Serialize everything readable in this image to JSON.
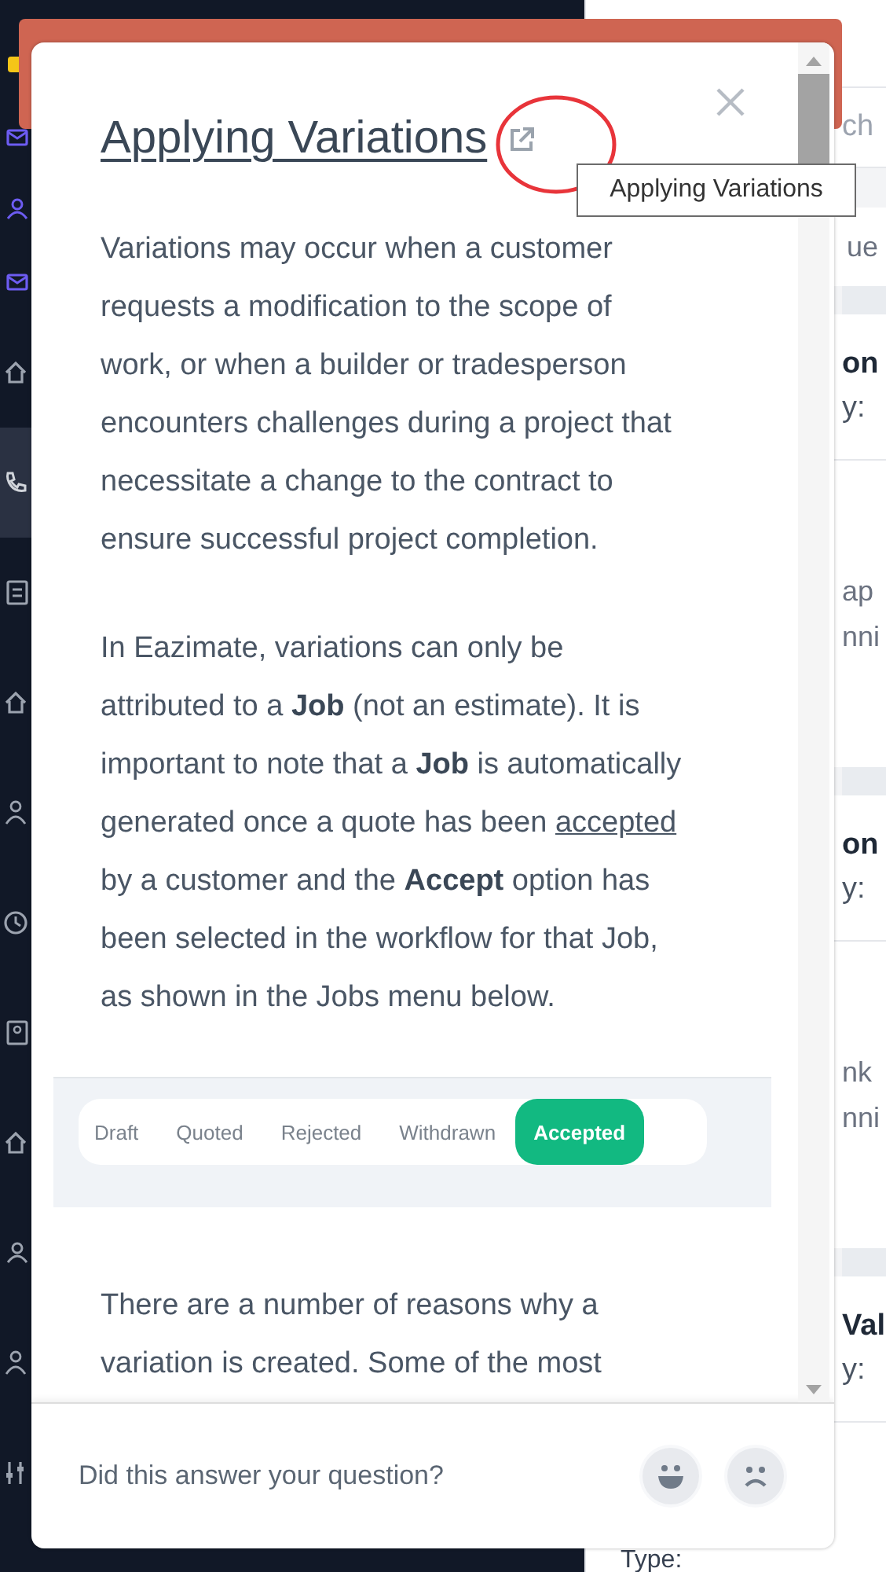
{
  "sidebar": {
    "items": [
      {
        "selected": false
      },
      {
        "selected": false
      },
      {
        "selected": false
      },
      {
        "selected": false
      },
      {
        "selected": false
      },
      {
        "selected": true
      },
      {
        "selected": false
      },
      {
        "selected": false
      },
      {
        "selected": false
      },
      {
        "selected": false
      },
      {
        "selected": false
      },
      {
        "selected": false
      },
      {
        "selected": false
      },
      {
        "selected": false
      },
      {
        "selected": false
      }
    ]
  },
  "background": {
    "search_placeholder": "ch",
    "column_label": "ue",
    "footer_label": "Type:",
    "list": [
      {
        "kind": "header",
        "title": "on",
        "meta": "y:"
      },
      {
        "kind": "body",
        "line_1": "ap",
        "line_2": "nni"
      },
      {
        "kind": "header",
        "title": "on",
        "meta": "y:"
      },
      {
        "kind": "body",
        "line_1": "nk",
        "line_2": "nni"
      },
      {
        "kind": "header",
        "title": "Val",
        "meta": "y:"
      }
    ]
  },
  "help_article": {
    "title": "Applying Variations",
    "tooltip": "Applying Variations",
    "content": [
      {
        "kind": "paragraph",
        "segments": [
          {
            "kind": "text",
            "text": "Variations may occur when a customer requests a modification to the scope of work, or when a builder or tradesperson encounters challenges during a project that necessitate a change to the contract to ensure successful project completion."
          }
        ]
      },
      {
        "kind": "paragraph",
        "segments": [
          {
            "kind": "text",
            "text": "In Eazimate, variations can only be attributed to a **Job** (not an estimate). It is important to note that a **Job** is automatically generated once a quote has been "
          },
          {
            "kind": "link",
            "text": "accepted"
          },
          {
            "kind": "text",
            "text": " by a customer and the **Accept** option has been selected in the workflow for that Job, as shown in the Jobs menu below."
          }
        ]
      },
      {
        "kind": "status_tabs",
        "tabs": [
          {
            "label": "Draft",
            "selected": false
          },
          {
            "label": "Quoted",
            "selected": false
          },
          {
            "label": "Rejected",
            "selected": false
          },
          {
            "label": "Withdrawn",
            "selected": false
          },
          {
            "label": "Accepted",
            "selected": true
          }
        ]
      },
      {
        "kind": "paragraph",
        "segments": [
          {
            "kind": "text",
            "text": "There are a number of reasons why a variation is created. Some of the most"
          }
        ]
      }
    ],
    "feedback": {
      "question": "Did this answer your question?"
    }
  }
}
